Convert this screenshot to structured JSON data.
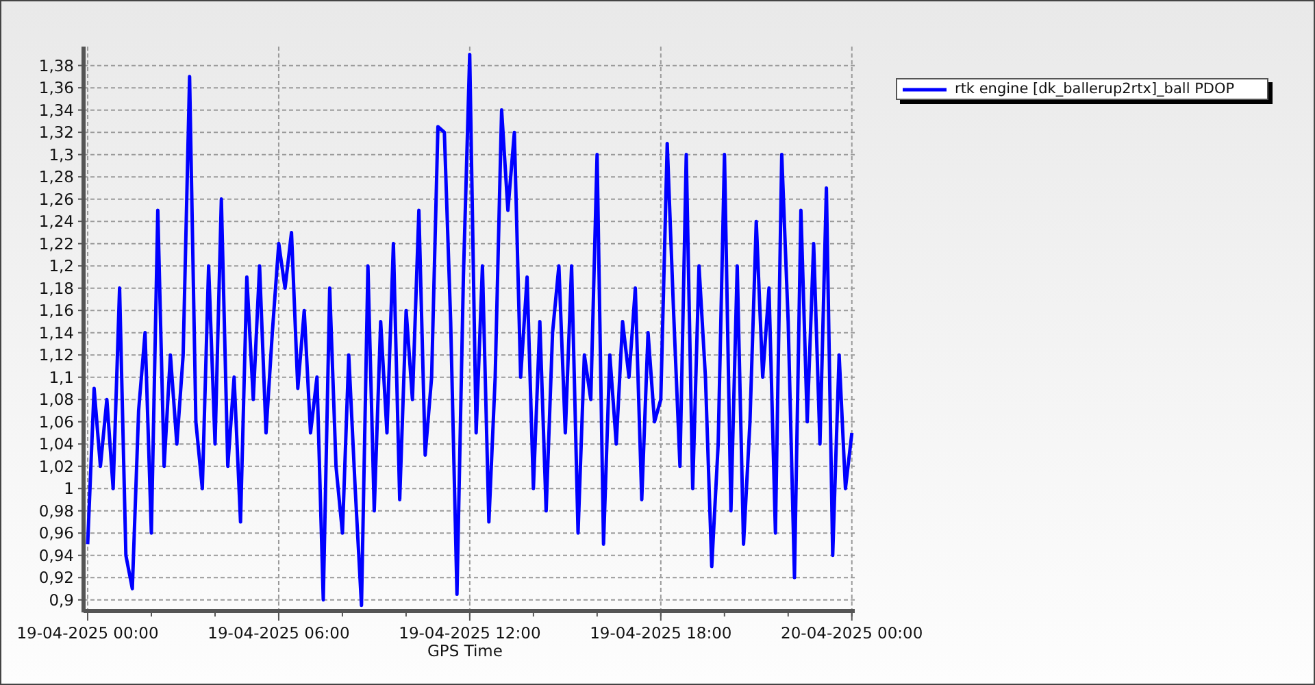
{
  "chart_data": {
    "type": "line",
    "grid": true,
    "xlabel": "GPS Time",
    "categories": [
      "19-04-2025 00:00",
      null,
      null,
      null,
      null,
      null,
      null,
      null,
      null,
      null,
      null,
      null,
      null,
      null,
      null,
      null,
      null,
      null,
      null,
      null,
      null,
      null,
      null,
      null,
      null,
      null,
      null,
      null,
      null,
      null,
      "19-04-2025 06:00",
      null,
      null,
      null,
      null,
      null,
      null,
      null,
      null,
      null,
      null,
      null,
      null,
      null,
      null,
      null,
      null,
      null,
      null,
      null,
      null,
      null,
      null,
      null,
      null,
      null,
      null,
      null,
      null,
      null,
      "19-04-2025 12:00",
      null,
      null,
      null,
      null,
      null,
      null,
      null,
      null,
      null,
      null,
      null,
      null,
      null,
      null,
      null,
      null,
      null,
      null,
      null,
      null,
      null,
      null,
      null,
      null,
      null,
      null,
      null,
      null,
      null,
      "19-04-2025 18:00",
      null,
      null,
      null,
      null,
      null,
      null,
      null,
      null,
      null,
      null,
      null,
      null,
      null,
      null,
      null,
      null,
      null,
      null,
      null,
      null,
      null,
      null,
      null,
      null,
      null,
      null,
      null,
      null,
      null,
      "20-04-2025 00:00"
    ],
    "series": [
      {
        "name": "rtk engine [dk_ballerup2rtx]_ball PDOP",
        "color": "#0000ff",
        "values": [
          0.95,
          1.09,
          1.02,
          1.08,
          1.0,
          1.18,
          0.94,
          0.91,
          1.07,
          1.14,
          0.96,
          1.25,
          1.02,
          1.12,
          1.04,
          1.12,
          1.37,
          1.06,
          1.0,
          1.2,
          1.04,
          1.26,
          1.02,
          1.1,
          0.97,
          1.19,
          1.08,
          1.2,
          1.05,
          1.14,
          1.22,
          1.18,
          1.23,
          1.09,
          1.16,
          1.05,
          1.1,
          0.9,
          1.18,
          1.02,
          0.96,
          1.12,
          1.0,
          0.895,
          1.2,
          0.98,
          1.15,
          1.05,
          1.22,
          0.99,
          1.16,
          1.08,
          1.25,
          1.03,
          1.1,
          1.325,
          1.32,
          1.15,
          0.905,
          1.19,
          1.39,
          1.05,
          1.2,
          0.97,
          1.1,
          1.34,
          1.25,
          1.32,
          1.1,
          1.19,
          1.0,
          1.15,
          0.98,
          1.14,
          1.2,
          1.05,
          1.2,
          0.96,
          1.12,
          1.08,
          1.3,
          0.95,
          1.12,
          1.04,
          1.15,
          1.1,
          1.18,
          0.99,
          1.14,
          1.06,
          1.08,
          1.31,
          1.16,
          1.02,
          1.3,
          1.0,
          1.2,
          1.1,
          0.93,
          1.04,
          1.3,
          0.98,
          1.2,
          0.95,
          1.06,
          1.24,
          1.1,
          1.18,
          0.96,
          1.3,
          1.15,
          0.92,
          1.25,
          1.06,
          1.22,
          1.04,
          1.27,
          0.94,
          1.12,
          1.0,
          1.05
        ]
      }
    ],
    "ylim": [
      0.89,
      1.397
    ],
    "yticks": [
      {
        "value": 0.9,
        "label": "0,9"
      },
      {
        "value": 0.92,
        "label": "0,92"
      },
      {
        "value": 0.94,
        "label": "0,94"
      },
      {
        "value": 0.96,
        "label": "0,96"
      },
      {
        "value": 0.98,
        "label": "0,98"
      },
      {
        "value": 1,
        "label": "1"
      },
      {
        "value": 1.02,
        "label": "1,02"
      },
      {
        "value": 1.04,
        "label": "1,04"
      },
      {
        "value": 1.06,
        "label": "1,06"
      },
      {
        "value": 1.08,
        "label": "1,08"
      },
      {
        "value": 1.1,
        "label": "1,1"
      },
      {
        "value": 1.12,
        "label": "1,12"
      },
      {
        "value": 1.14,
        "label": "1,14"
      },
      {
        "value": 1.16,
        "label": "1,16"
      },
      {
        "value": 1.18,
        "label": "1,18"
      },
      {
        "value": 1.2,
        "label": "1,2"
      },
      {
        "value": 1.22,
        "label": "1,22"
      },
      {
        "value": 1.24,
        "label": "1,24"
      },
      {
        "value": 1.26,
        "label": "1,26"
      },
      {
        "value": 1.28,
        "label": "1,28"
      },
      {
        "value": 1.3,
        "label": "1,3"
      },
      {
        "value": 1.32,
        "label": "1,32"
      },
      {
        "value": 1.34,
        "label": "1,34"
      },
      {
        "value": 1.36,
        "label": "1,36"
      },
      {
        "value": 1.38,
        "label": "1,38"
      }
    ]
  }
}
